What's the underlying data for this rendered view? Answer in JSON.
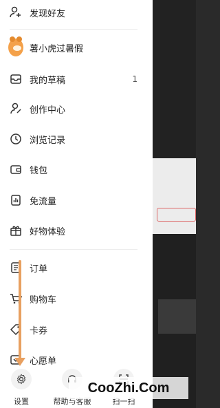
{
  "menu": {
    "items": [
      {
        "label": "发现好友",
        "icon": "person-add-icon"
      },
      {
        "label": "薯小虎过暑假",
        "icon": "tiger-avatar-icon"
      },
      {
        "label": "我的草稿",
        "icon": "drafts-inbox-icon",
        "count": "1"
      },
      {
        "label": "创作中心",
        "icon": "creator-person-icon"
      },
      {
        "label": "浏览记录",
        "icon": "history-clock-icon"
      },
      {
        "label": "钱包",
        "icon": "wallet-icon"
      },
      {
        "label": "免流量",
        "icon": "data-free-icon"
      },
      {
        "label": "好物体验",
        "icon": "gift-icon"
      },
      {
        "label": "订单",
        "icon": "order-list-icon"
      },
      {
        "label": "购物车",
        "icon": "cart-icon"
      },
      {
        "label": "卡券",
        "icon": "coupon-tag-icon"
      },
      {
        "label": "心愿单",
        "icon": "wishlist-icon"
      }
    ]
  },
  "bottom_bar": {
    "settings": "设置",
    "help": "帮助与客服",
    "scan": "扫一扫"
  },
  "watermark": "CooZhi.Com",
  "accent_color": "#e8a060"
}
